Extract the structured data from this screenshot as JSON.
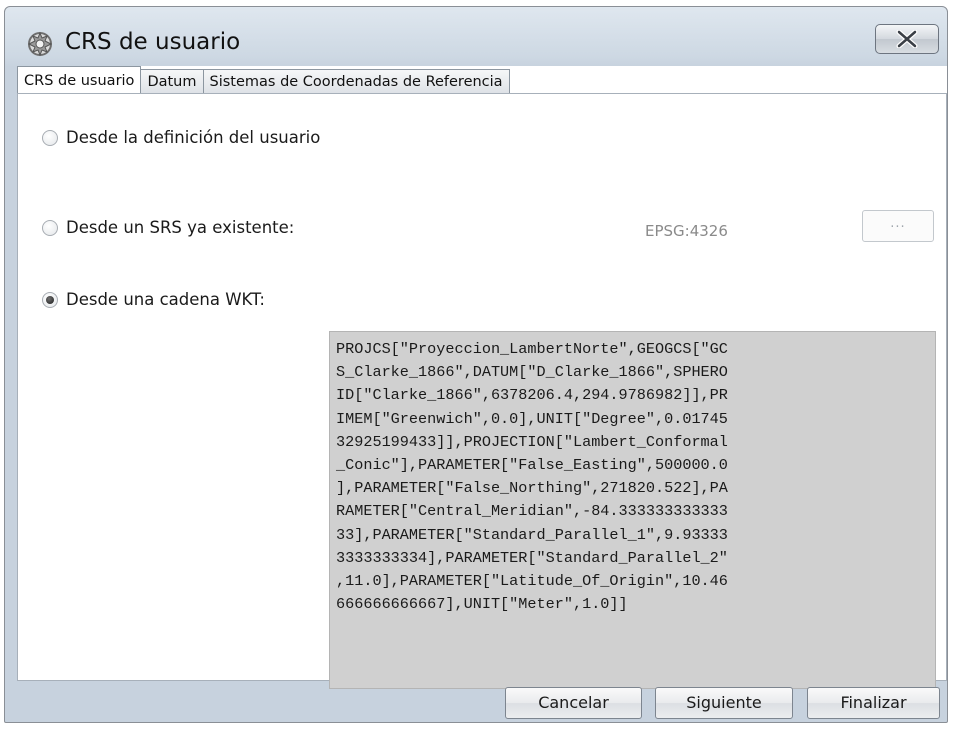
{
  "window": {
    "title": "CRS de usuario",
    "icon": "globe-gear-icon",
    "close_icon": "close-icon"
  },
  "tabs": [
    {
      "label": "CRS de usuario",
      "active": true
    },
    {
      "label": "Datum",
      "active": false
    },
    {
      "label": "Sistemas de Coordenadas de Referencia",
      "active": false
    }
  ],
  "options": [
    {
      "label": "Desde la definición del usuario",
      "checked": false
    },
    {
      "label": "Desde un SRS ya existente:",
      "checked": false
    },
    {
      "label": "Desde una cadena WKT:",
      "checked": true
    }
  ],
  "srs": {
    "value": "EPSG:4326",
    "browse_label": "..."
  },
  "wkt": {
    "lines": [
      "PROJCS[\"Proyeccion_LambertNorte\",GEOGCS[\"GC",
      "S_Clarke_1866\",DATUM[\"D_Clarke_1866\",SPHERO",
      "ID[\"Clarke_1866\",6378206.4,294.9786982]],PR",
      "IMEM[\"Greenwich\",0.0],UNIT[\"Degree\",0.01745",
      "32925199433]],PROJECTION[\"Lambert_Conformal",
      "_Conic\"],PARAMETER[\"False_Easting\",500000.0",
      "],PARAMETER[\"False_Northing\",271820.522],PA",
      "RAMETER[\"Central_Meridian\",-84.333333333333",
      "33],PARAMETER[\"Standard_Parallel_1\",9.93333",
      "3333333334],PARAMETER[\"Standard_Parallel_2\"",
      ",11.0],PARAMETER[\"Latitude_Of_Origin\",10.46",
      "666666666667],UNIT[\"Meter\",1.0]]"
    ]
  },
  "buttons": {
    "cancel": "Cancelar",
    "next": "Siguiente",
    "finish": "Finalizar"
  }
}
